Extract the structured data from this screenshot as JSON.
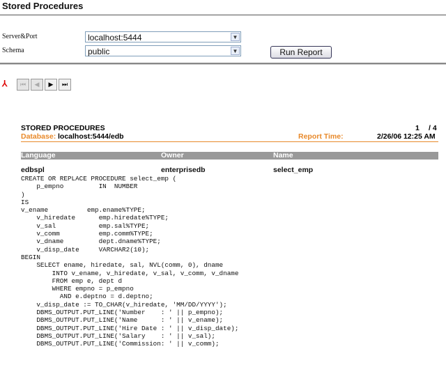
{
  "title": "Stored Procedures",
  "form": {
    "server_label": "Server&Port",
    "server_value": "localhost:5444",
    "schema_label": "Schema",
    "schema_value": "public",
    "run_label": "Run Report"
  },
  "toolbar": {
    "first": "⏮",
    "prev": "◀",
    "next": "▶",
    "last": "⏭"
  },
  "report": {
    "heading": "STORED PROCEDURES",
    "page_current": "1",
    "page_total": "/ 4",
    "database_label": "Database:",
    "database_value": "localhost:5444/edb",
    "time_label": "Report Time:",
    "time_value": "2/26/06 12:25 AM",
    "columns": [
      "Language",
      "Owner",
      "Name"
    ],
    "row": [
      "edbspl",
      "enterprisedb",
      "select_emp"
    ],
    "code": "CREATE OR REPLACE PROCEDURE select_emp (\n    p_empno         IN  NUMBER\n)\nIS\nv_ename          emp.ename%TYPE;\n    v_hiredate      emp.hiredate%TYPE;\n    v_sal           emp.sal%TYPE;\n    v_comm          emp.comm%TYPE;\n    v_dname         dept.dname%TYPE;\n    v_disp_date     VARCHAR2(10);\nBEGIN\n    SELECT ename, hiredate, sal, NVL(comm, 0), dname\n        INTO v_ename, v_hiredate, v_sal, v_comm, v_dname\n        FROM emp e, dept d\n        WHERE empno = p_empno\n          AND e.deptno = d.deptno;\n    v_disp_date := TO_CHAR(v_hiredate, 'MM/DD/YYYY');\n    DBMS_OUTPUT.PUT_LINE('Number    : ' || p_empno);\n    DBMS_OUTPUT.PUT_LINE('Name      : ' || v_ename);\n    DBMS_OUTPUT.PUT_LINE('Hire Date : ' || v_disp_date);\n    DBMS_OUTPUT.PUT_LINE('Salary    : ' || v_sal);\n    DBMS_OUTPUT.PUT_LINE('Commission: ' || v_comm);"
  }
}
